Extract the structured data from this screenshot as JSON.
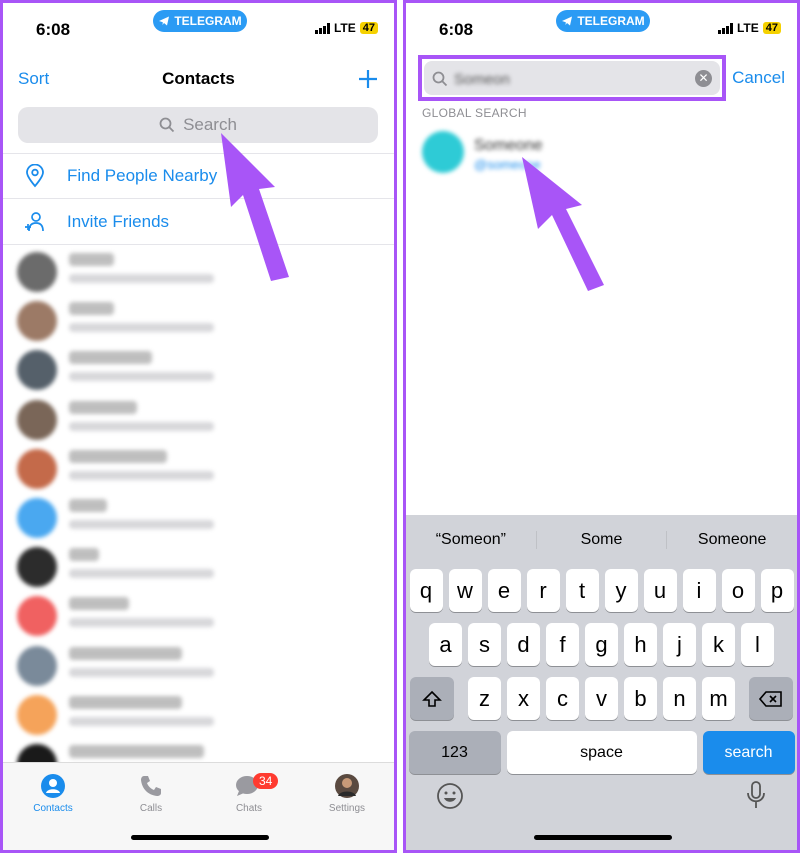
{
  "left": {
    "status": {
      "time": "6:08",
      "app_pill": "TELEGRAM",
      "network": "LTE",
      "battery": "47"
    },
    "nav": {
      "sort": "Sort",
      "title": "Contacts"
    },
    "search": {
      "placeholder": "Search"
    },
    "actions": [
      {
        "label": "Find People Nearby",
        "icon": "location-pin-icon"
      },
      {
        "label": "Invite Friends",
        "icon": "add-person-icon"
      }
    ],
    "contacts": [
      {
        "name": "Darryl",
        "status": "last seen 9 minutes ago",
        "color": "#6b6b6b"
      },
      {
        "name": "Vishnu",
        "status": "last seen 9 minutes ago",
        "color": "#9c7a66"
      },
      {
        "name": "Amar Bindra",
        "status": "last seen 9 minutes ago",
        "color": "#55606a"
      },
      {
        "name": "Raj Batra",
        "status": "last seen 9 minutes ago",
        "color": "#7a6658"
      },
      {
        "name": "Dhanish Patel",
        "status": "last seen 9 minutes ago",
        "color": "#c46a4a"
      },
      {
        "name": "Aasim",
        "status": "last seen 25 minutes ago",
        "color": "#4aa8f0"
      },
      {
        "name": "Arav",
        "status": "last seen 38 minutes ago",
        "color": "#2c2c2c"
      },
      {
        "name": "Shashank",
        "status": "last seen 38 minutes ago",
        "color": "#f06161"
      },
      {
        "name": "Suraj Padmasali",
        "status": "last seen 40 minutes ago",
        "color": "#7a8a9a"
      },
      {
        "name": "Tanmoli Abhinav",
        "status": "last seen 40 minutes ago",
        "color": "#f5a35a"
      },
      {
        "name": "Satyam (Ayoo Mama)",
        "status": "last seen 41 minutes ago",
        "color": "#1a1a1a"
      }
    ],
    "tabs": [
      {
        "label": "Contacts",
        "icon": "person-circle-icon"
      },
      {
        "label": "Calls",
        "icon": "phone-icon"
      },
      {
        "label": "Chats",
        "icon": "chat-bubbles-icon",
        "badge": "34"
      },
      {
        "label": "Settings",
        "icon": "profile-avatar-icon"
      }
    ],
    "accent": "#1a8cec",
    "highlight": "#a855f7"
  },
  "right": {
    "status": {
      "time": "6:08",
      "app_pill": "TELEGRAM",
      "network": "LTE",
      "battery": "47"
    },
    "search": {
      "value": "Someon",
      "cancel": "Cancel"
    },
    "section_title": "GLOBAL SEARCH",
    "result": {
      "name": "Someone",
      "username": "@someone"
    },
    "suggestions": [
      "“Someon”",
      "Some",
      "Someone"
    ],
    "keys": {
      "row1": [
        "q",
        "w",
        "e",
        "r",
        "t",
        "y",
        "u",
        "i",
        "o",
        "p"
      ],
      "row2": [
        "a",
        "s",
        "d",
        "f",
        "g",
        "h",
        "j",
        "k",
        "l"
      ],
      "row3": [
        "z",
        "x",
        "c",
        "v",
        "b",
        "n",
        "m"
      ],
      "numbers": "123",
      "space": "space",
      "action": "search"
    }
  }
}
